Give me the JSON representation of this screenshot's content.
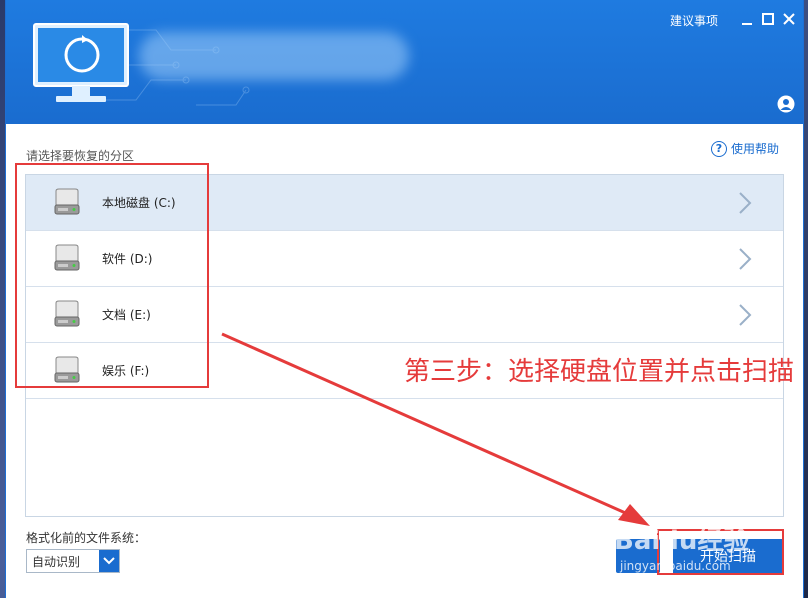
{
  "header": {
    "suggestion_link": "建议事项"
  },
  "partition_section": {
    "label": "请选择要恢复的分区",
    "help_link": "使用帮助",
    "help_icon_glyph": "?"
  },
  "partitions": [
    {
      "label": "本地磁盘 (C:)",
      "selected": true
    },
    {
      "label": "软件 (D:)",
      "selected": false
    },
    {
      "label": "文档 (E:)",
      "selected": false
    },
    {
      "label": "娱乐 (F:)",
      "selected": false
    }
  ],
  "filesystem": {
    "label": "格式化前的文件系统：",
    "selected_value": "自动识别"
  },
  "buttons": {
    "scan_label": "开始扫描"
  },
  "annotation": {
    "text": "第三步：选择硬盘位置并点击扫描",
    "color": "#e53b3b"
  },
  "watermark": {
    "brand": "Baidu经验",
    "url": "jingyan.baidu.com"
  },
  "colors": {
    "accent": "#1a6ccf",
    "selected_row": "#dfeaf6"
  }
}
